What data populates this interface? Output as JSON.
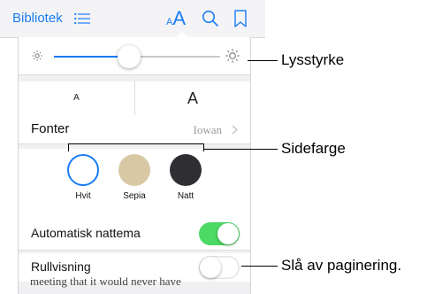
{
  "toolbar": {
    "library_label": "Bibliotek",
    "list_icon": "list-icon",
    "text_size_small": "A",
    "text_size_big": "A",
    "search_icon": "search-icon",
    "bookmark_icon": "bookmark-icon",
    "accent_color": "#1a7cf5"
  },
  "brightness": {
    "level": 0.45,
    "low_icon": "sun-small-icon",
    "high_icon": "sun-big-icon"
  },
  "text_size": {
    "decrease_label": "A",
    "increase_label": "A"
  },
  "font": {
    "label": "Fonter",
    "value": "Iowan"
  },
  "page_colors": {
    "selected": "Hvit",
    "items": [
      {
        "label": "Hvit",
        "color": "#ffffff",
        "selected": true
      },
      {
        "label": "Sepia",
        "color": "#d8c9a4",
        "selected": false
      },
      {
        "label": "Natt",
        "color": "#2f2f33",
        "selected": false
      }
    ]
  },
  "auto_night": {
    "label": "Automatisk nattema",
    "enabled": true,
    "on_color": "#4cd964"
  },
  "scroll_view": {
    "label": "Rullvisning",
    "enabled": false
  },
  "background_text": "meeting that it would never have",
  "callouts": {
    "brightness": "Lysstyrke",
    "page_color": "Sidefarge",
    "pagination": "Slå av paginering."
  }
}
